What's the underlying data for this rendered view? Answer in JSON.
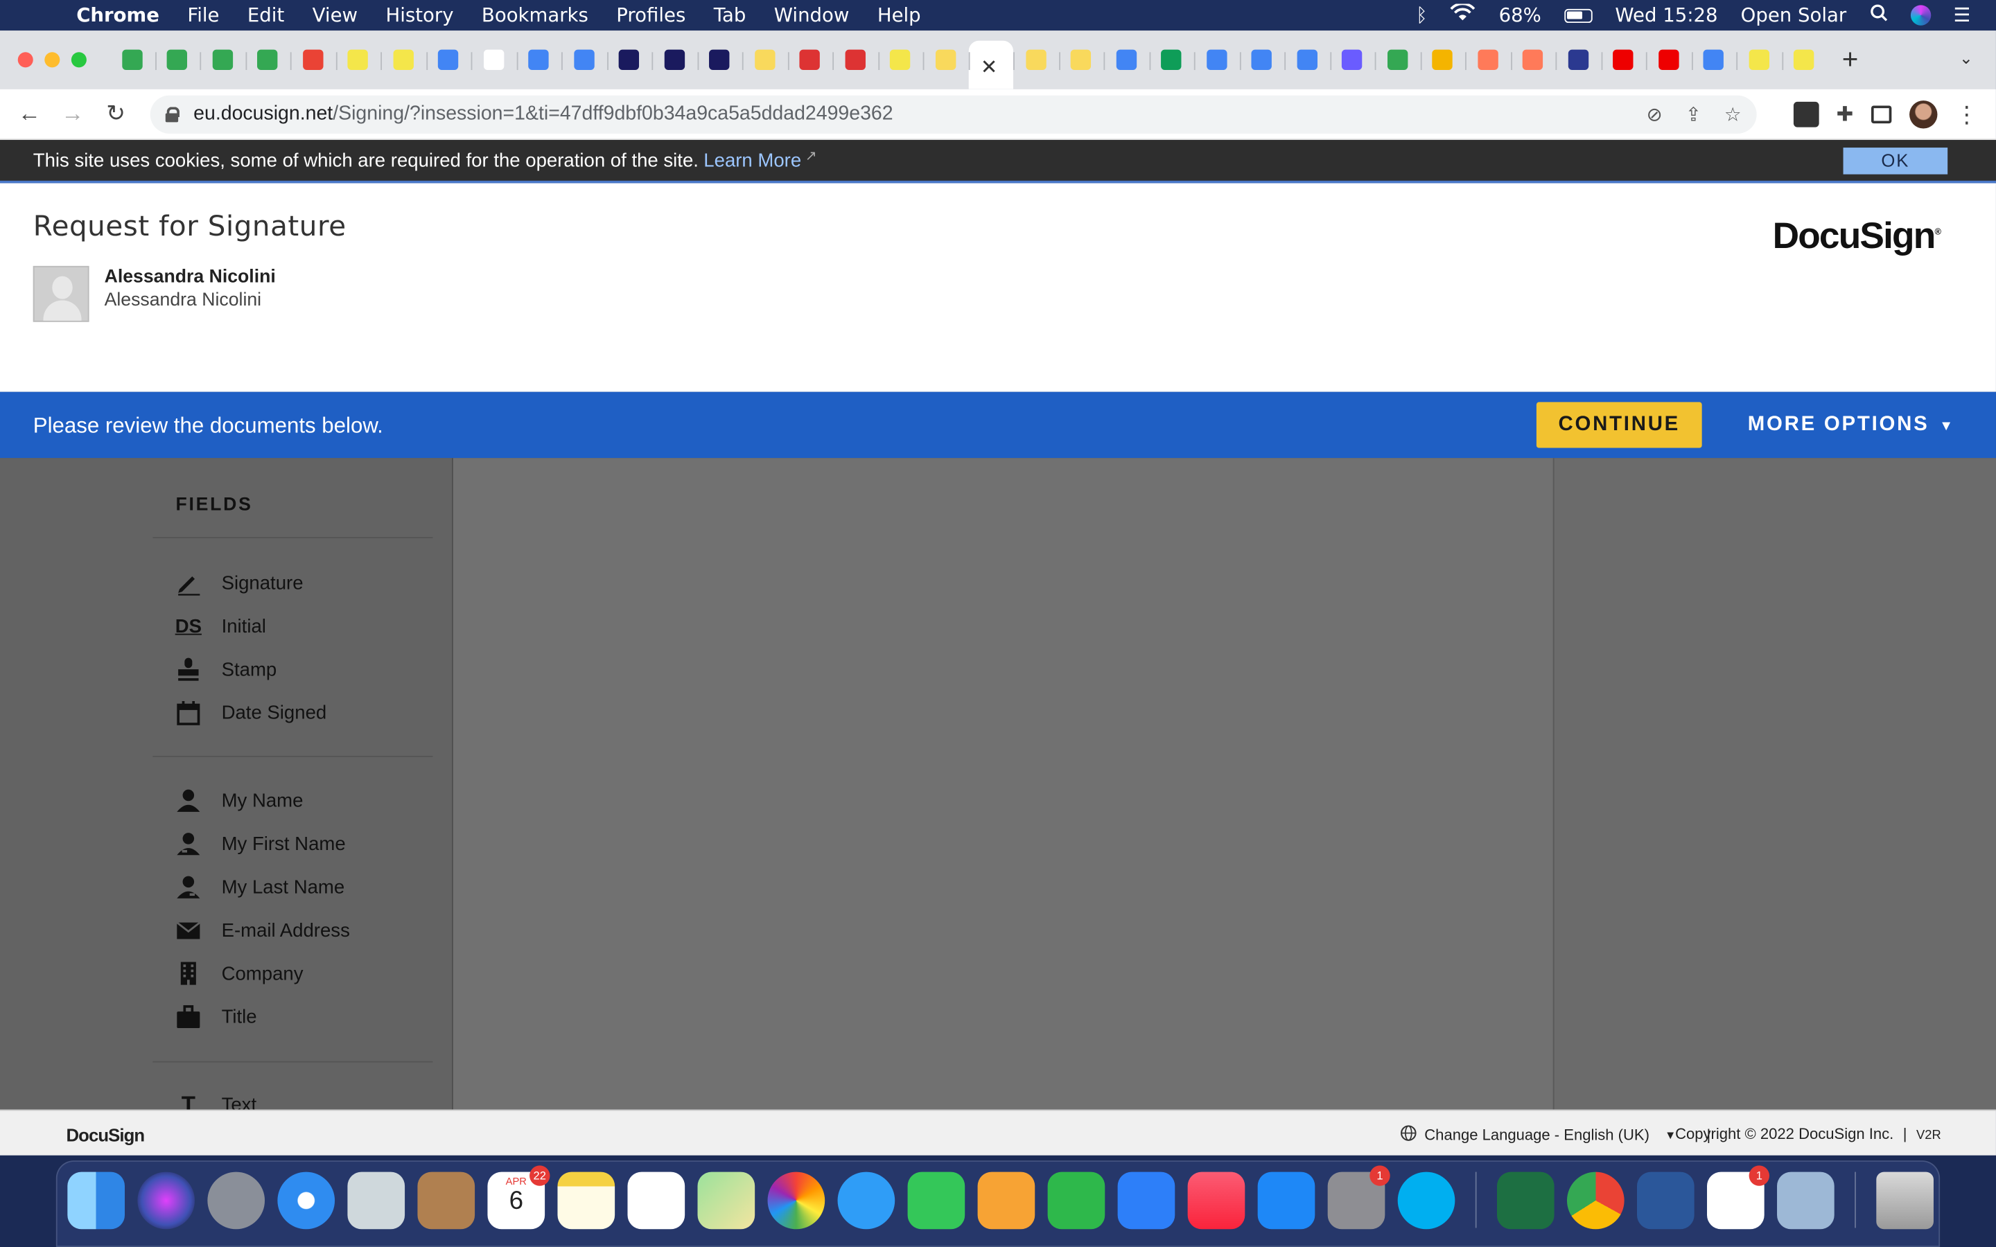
{
  "menubar": {
    "app": "Chrome",
    "items": [
      "File",
      "Edit",
      "View",
      "History",
      "Bookmarks",
      "Profiles",
      "Tab",
      "Window",
      "Help"
    ],
    "battery": "68%",
    "datetime": "Wed 15:28",
    "status_app": "Open Solar"
  },
  "browser": {
    "url_host": "eu.docusign.net",
    "url_path": "/Signing/?insession=1&ti=47dff9dbf0b34a9ca5a5ddad2499e362",
    "tab_favicons": [
      "#34a853",
      "#34a853",
      "#34a853",
      "#34a853",
      "#ea4335",
      "#f4e64a",
      "#f4e64a",
      "#4285f4",
      "#fff",
      "#4285f4",
      "#4285f4",
      "#1a1a5e",
      "#1a1a5e",
      "#1a1a5e",
      "#f9d95c",
      "#d33",
      "#d33",
      "#f4e64a",
      "#f9d95c",
      "active",
      "#f9d95c",
      "#f9d95c",
      "#4285f4",
      "#0f9d58",
      "#4285f4",
      "#4285f4",
      "#4285f4",
      "#6a5cff",
      "#34a853",
      "#f4b400",
      "#ff7a59",
      "#ff7a59",
      "#2b3990",
      "#e00",
      "#e00",
      "#4285f4",
      "#f4e64a",
      "#f4e64a"
    ]
  },
  "cookie_bar": {
    "text": "This site uses cookies, some of which are required for the operation of the site.",
    "link": "Learn More",
    "ok": "OK"
  },
  "header": {
    "title": "Request for Signature",
    "sender_name": "Alessandra Nicolini",
    "sender_sub": "Alessandra Nicolini",
    "logo": "DocuSign"
  },
  "actionbar": {
    "message": "Please review the documents below.",
    "continue": "CONTINUE",
    "more_options": "MORE OPTIONS"
  },
  "sidebar": {
    "heading": "FIELDS",
    "group1": [
      {
        "label": "Signature",
        "icon": "pen-icon"
      },
      {
        "label": "Initial",
        "icon": "ds-initial-icon"
      },
      {
        "label": "Stamp",
        "icon": "stamp-icon"
      },
      {
        "label": "Date Signed",
        "icon": "calendar-icon"
      }
    ],
    "group2": [
      {
        "label": "My Name",
        "icon": "person-icon"
      },
      {
        "label": "My First Name",
        "icon": "person-first-icon"
      },
      {
        "label": "My Last Name",
        "icon": "person-last-icon"
      },
      {
        "label": "E-mail Address",
        "icon": "envelope-icon"
      },
      {
        "label": "Company",
        "icon": "building-icon"
      },
      {
        "label": "Title",
        "icon": "briefcase-icon"
      }
    ],
    "group3": [
      {
        "label": "Text",
        "icon": "text-icon"
      }
    ]
  },
  "footer": {
    "logo": "DocuSign",
    "language": "Change Language - English (UK)",
    "copyright": "Copyright © 2022 DocuSign Inc.",
    "version": "V2R"
  },
  "dock": {
    "calendar_month": "APR",
    "calendar_day": "6",
    "calendar_badge": "22",
    "settings_badge": "1",
    "slack_badge": "1"
  }
}
